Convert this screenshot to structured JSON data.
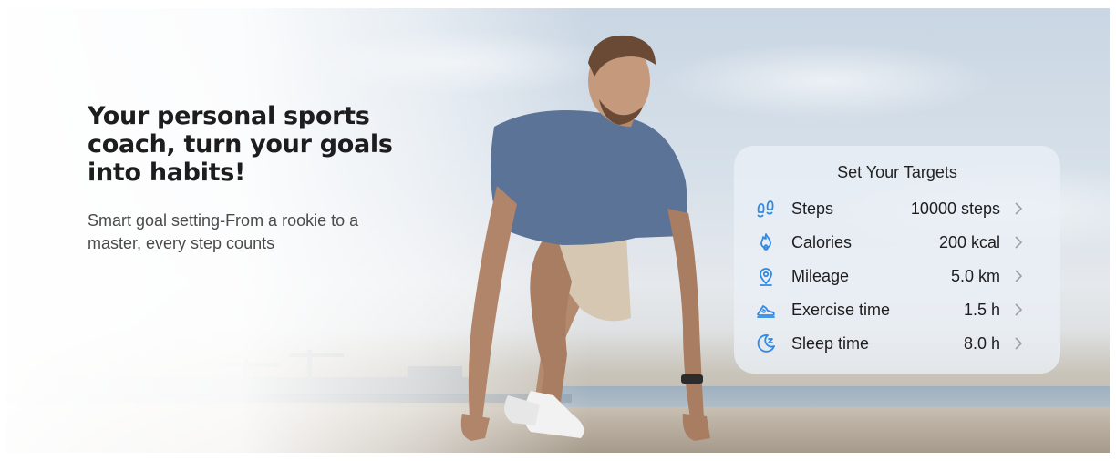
{
  "hero": {
    "headline": "Your personal sports coach, turn your goals into habits!",
    "subline": "Smart goal setting-From a rookie to a master, every step counts"
  },
  "targets": {
    "title": "Set Your Targets",
    "items": [
      {
        "icon": "footprints-icon",
        "label": "Steps",
        "value": "10000 steps"
      },
      {
        "icon": "flame-icon",
        "label": "Calories",
        "value": "200 kcal"
      },
      {
        "icon": "location-pin-icon",
        "label": "Mileage",
        "value": "5.0 km"
      },
      {
        "icon": "running-shoe-icon",
        "label": "Exercise time",
        "value": "1.5 h"
      },
      {
        "icon": "moon-sleep-icon",
        "label": "Sleep time",
        "value": "8.0 h"
      }
    ]
  },
  "colors": {
    "accent": "#2f8ae5",
    "headline": "#1d1d1f",
    "subline": "#4a4a4a",
    "chevron": "#9aa0a6"
  }
}
